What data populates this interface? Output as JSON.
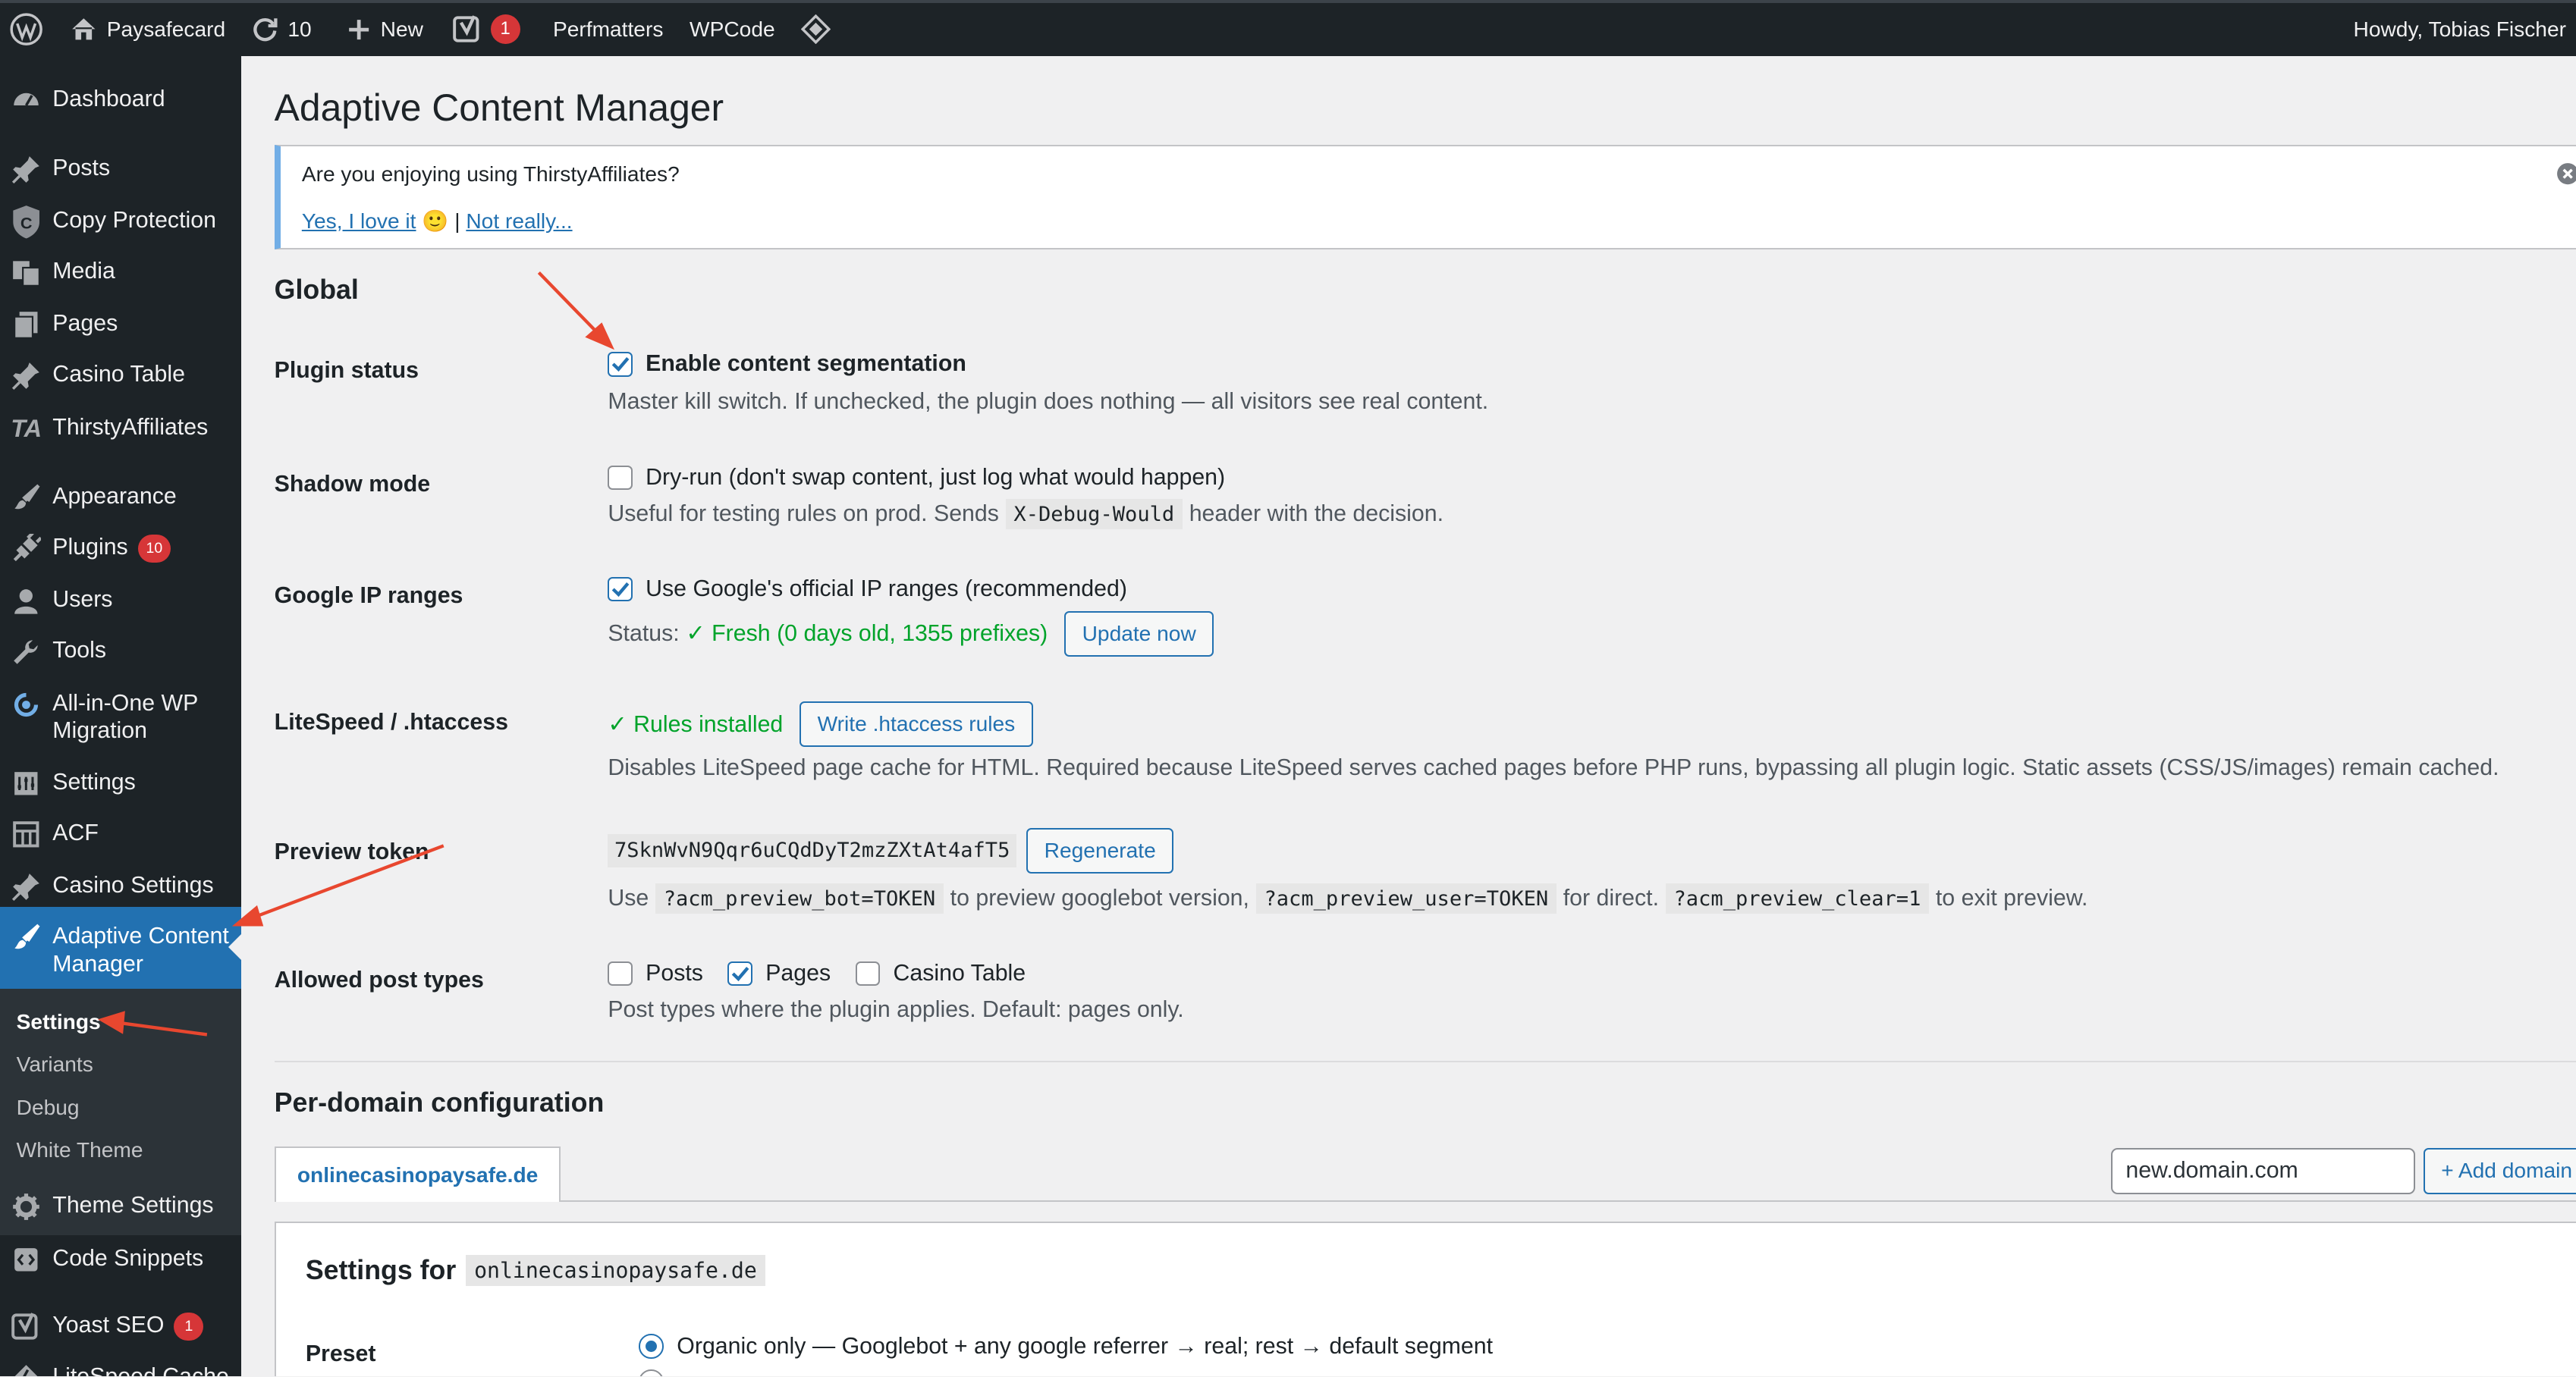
{
  "admin_bar": {
    "site_name": "Paysafecard",
    "updates_count": "10",
    "new_label": "New",
    "yoast_badge": "1",
    "perfmatters": "Perfmatters",
    "wpcode": "WPCode",
    "howdy": "Howdy, Tobias Fischer"
  },
  "sidebar": {
    "items": [
      {
        "label": "Dashboard",
        "icon": "dashboard-icon"
      },
      {
        "label": "Posts",
        "icon": "pin-icon"
      },
      {
        "label": "Copy Protection",
        "icon": "shield-icon"
      },
      {
        "label": "Media",
        "icon": "media-icon"
      },
      {
        "label": "Pages",
        "icon": "pages-icon"
      },
      {
        "label": "Casino Table",
        "icon": "pin-icon"
      },
      {
        "label": "ThirstyAffiliates",
        "icon": "ta-logo-icon",
        "logo_text": "TA"
      },
      {
        "label": "Appearance",
        "icon": "brush-icon"
      },
      {
        "label": "Plugins",
        "icon": "plugin-icon",
        "badge": "10"
      },
      {
        "label": "Users",
        "icon": "users-icon"
      },
      {
        "label": "Tools",
        "icon": "wrench-icon"
      },
      {
        "label": "All-in-One WP Migration",
        "icon": "migration-icon"
      },
      {
        "label": "Settings",
        "icon": "settings-icon"
      },
      {
        "label": "ACF",
        "icon": "acf-icon"
      },
      {
        "label": "Casino Settings",
        "icon": "pin-icon"
      },
      {
        "label": "Adaptive Content Manager",
        "icon": "brush-icon"
      },
      {
        "label": "Theme Settings",
        "icon": "gear-icon"
      },
      {
        "label": "Code Snippets",
        "icon": "code-icon"
      },
      {
        "label": "Yoast SEO",
        "icon": "yoast-icon",
        "badge": "1"
      },
      {
        "label": "LiteSpeed Cache",
        "icon": "litespeed-icon"
      }
    ],
    "submenu": [
      "Settings",
      "Variants",
      "Debug",
      "White Theme"
    ]
  },
  "page": {
    "title": "Adaptive Content Manager",
    "notice": {
      "question": "Are you enjoying using ThirstyAffiliates?",
      "yes": "Yes, I love it",
      "emoji": "🙂",
      "separator": "|",
      "no": "Not really..."
    },
    "global_heading": "Global",
    "plugin_status": {
      "label": "Plugin status",
      "checkbox": "Enable content segmentation",
      "checked": true,
      "desc": "Master kill switch. If unchecked, the plugin does nothing — all visitors see real content."
    },
    "shadow_mode": {
      "label": "Shadow mode",
      "checkbox": "Dry-run (don't swap content, just log what would happen)",
      "checked": false,
      "desc_before": "Useful for testing rules on prod. Sends",
      "desc_code": "X-Debug-Would",
      "desc_after": "header with the decision."
    },
    "google_ip": {
      "label": "Google IP ranges",
      "checkbox": "Use Google's official IP ranges (recommended)",
      "checked": true,
      "status_label": "Status:",
      "status_value": "✓ Fresh (0 days old, 1355 prefixes)",
      "button": "Update now"
    },
    "litespeed": {
      "label": "LiteSpeed / .htaccess",
      "status": "✓ Rules installed",
      "button": "Write .htaccess rules",
      "desc": "Disables LiteSpeed page cache for HTML. Required because LiteSpeed serves cached pages before PHP runs, bypassing all plugin logic. Static assets (CSS/JS/images) remain cached."
    },
    "preview_token": {
      "label": "Preview token",
      "token": "7SknWvN9Qqr6uCQdDyT2mzZXtAt4afT5",
      "button": "Regenerate",
      "use": "Use",
      "code1": "?acm_preview_bot=TOKEN",
      "text1": "to preview googlebot version,",
      "code2": "?acm_preview_user=TOKEN",
      "text2": "for direct.",
      "code3": "?acm_preview_clear=1",
      "text3": "to exit preview."
    },
    "post_types": {
      "label": "Allowed post types",
      "options": [
        {
          "label": "Posts",
          "checked": false
        },
        {
          "label": "Pages",
          "checked": true
        },
        {
          "label": "Casino Table",
          "checked": false
        }
      ],
      "desc": "Post types where the plugin applies. Default: pages only."
    },
    "per_domain": {
      "heading": "Per-domain configuration",
      "tab": "onlinecasinopaysafe.de",
      "input_value": "new.domain.com",
      "add_button": "+ Add domain",
      "settings_for": "Settings for",
      "settings_domain": "onlinecasinopaysafe.de",
      "preset_label": "Preset",
      "preset_option": "Organic only — Googlebot + any google referrer → real; rest → default segment"
    }
  },
  "colors": {
    "admin_bar": "#1d2327",
    "accent": "#2271b1",
    "badge": "#d63638",
    "success": "#00a32a",
    "annotation": "#e8472f"
  }
}
